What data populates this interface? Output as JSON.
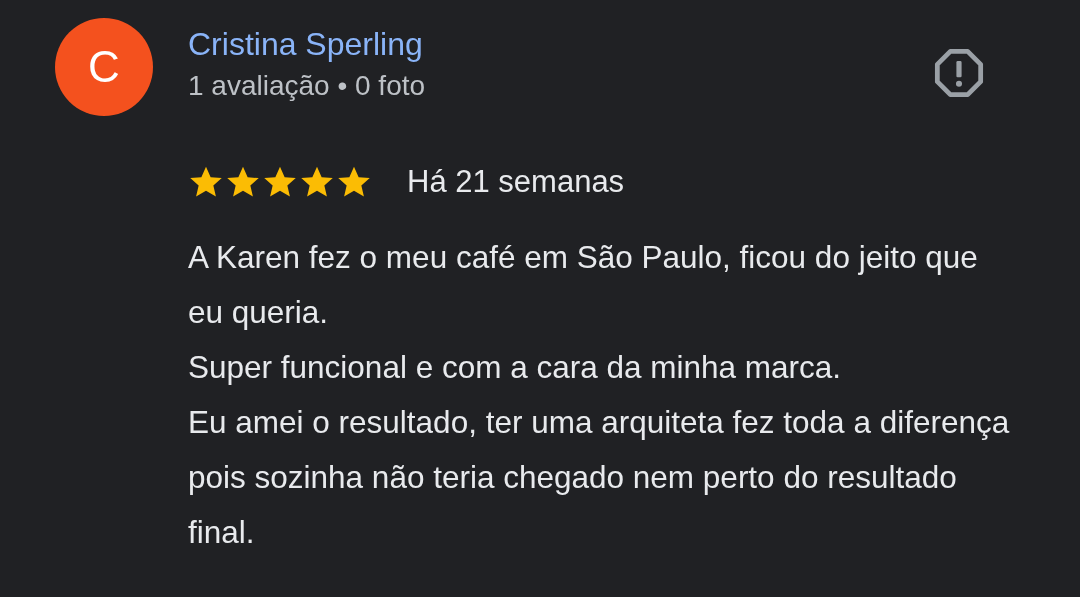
{
  "review": {
    "author": {
      "initial": "C",
      "name": "Cristina Sperling",
      "color": "#f4511e"
    },
    "stats": "1 avaliação • 0 foto",
    "stars": 5,
    "time": "Há 21 semanas",
    "paragraphs": [
      "A Karen fez o meu café em São Paulo, ficou do jeito que eu queria.",
      "Super funcional e com a cara da minha marca.",
      "Eu amei o resultado, ter uma arquiteta fez toda a diferença pois sozinha não teria chegado nem perto do resultado final."
    ]
  }
}
